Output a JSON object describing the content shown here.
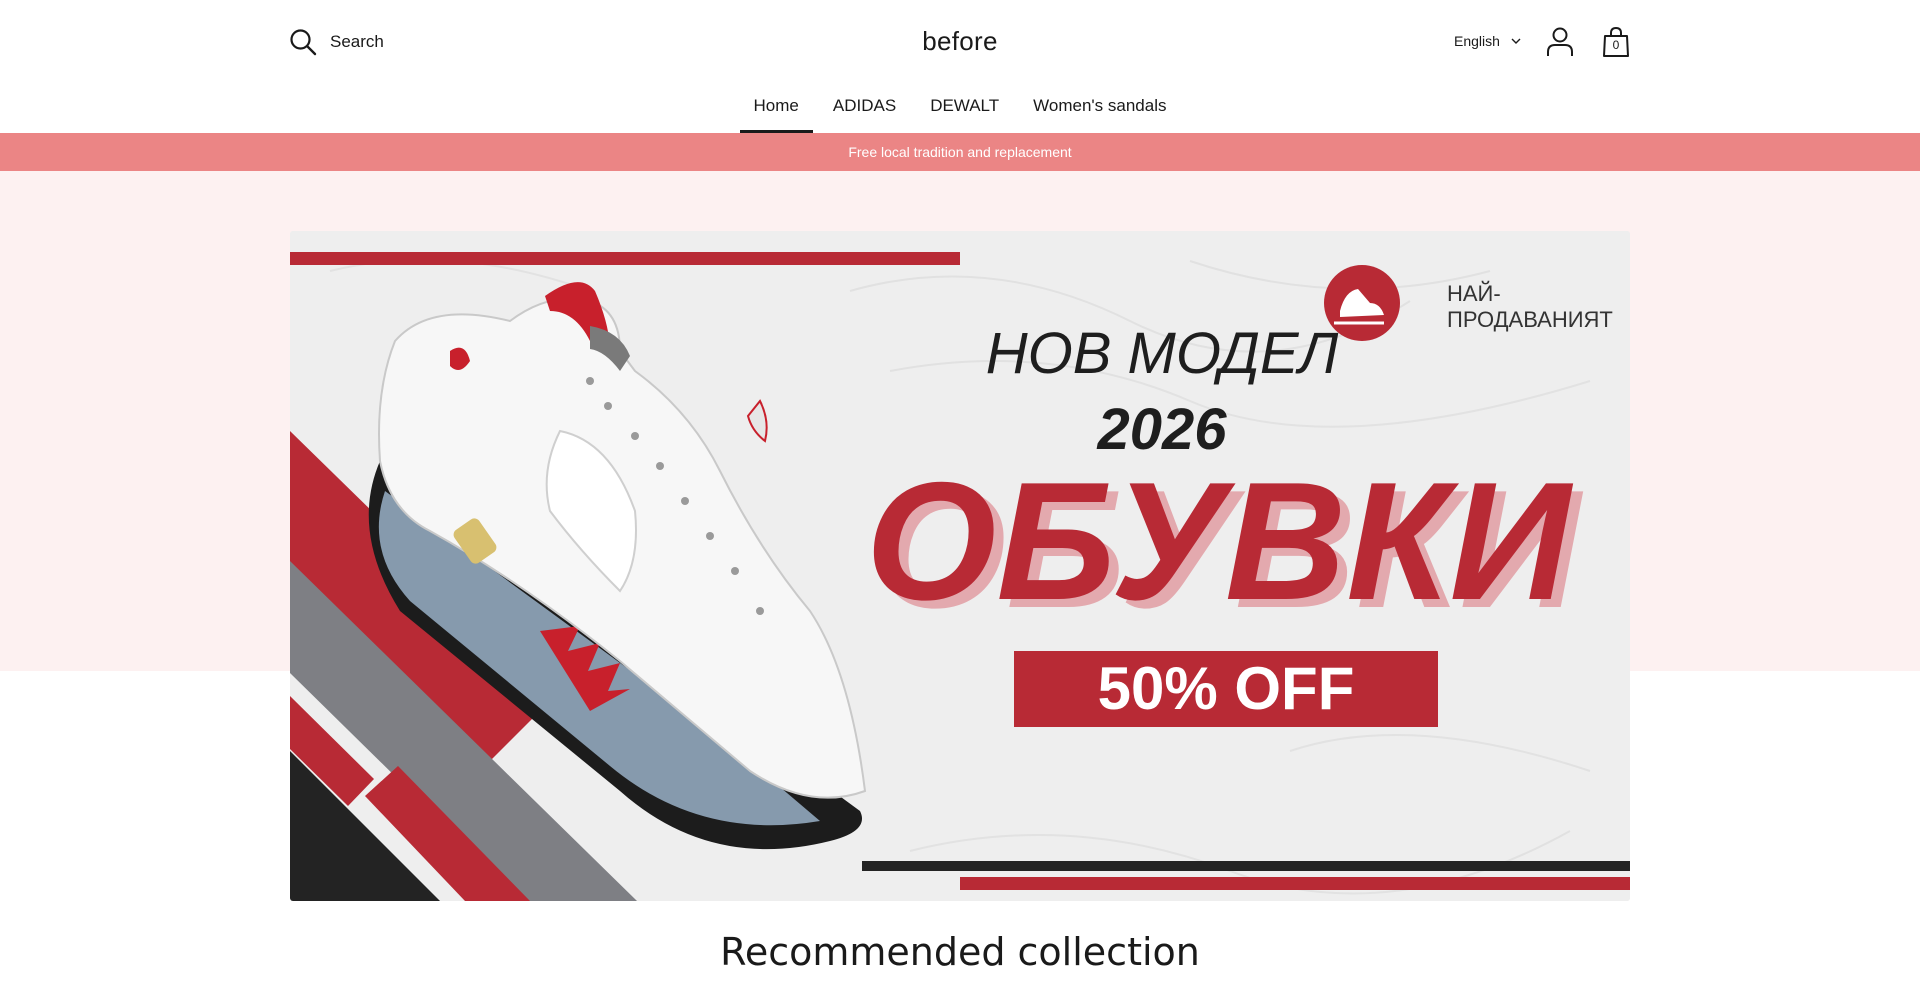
{
  "header": {
    "search_label": "Search",
    "logo": "before",
    "language": "English",
    "cart_count": "0"
  },
  "nav": {
    "items": [
      {
        "label": "Home",
        "active": true
      },
      {
        "label": "ADIDAS",
        "active": false
      },
      {
        "label": "DEWALT",
        "active": false
      },
      {
        "label": "Women's sandals",
        "active": false
      }
    ]
  },
  "announcement": "Free local tradition and replacement",
  "banner": {
    "badge_line1": "НАЙ-",
    "badge_line2": "ПРОДАВАНИЯТ",
    "headline": "НОВ МОДЕЛ",
    "year": "2026",
    "title": "ОБУВКИ",
    "discount": "50% OFF"
  },
  "colors": {
    "accent_red": "#b82a35",
    "announcement_bg": "#eb8585",
    "hero_bg": "#fdf1f1"
  },
  "section": {
    "title": "Recommended collection"
  }
}
